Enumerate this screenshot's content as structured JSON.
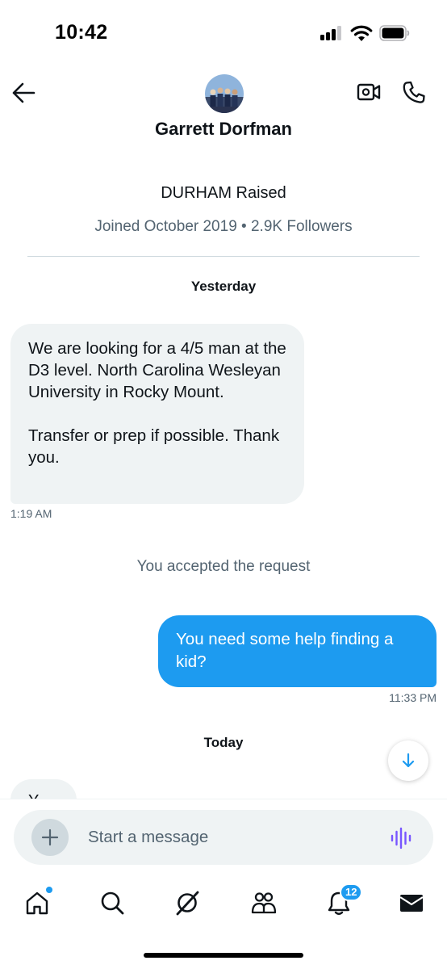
{
  "status_bar": {
    "time": "10:42",
    "signal_bars_active": 3,
    "signal_bars_total": 4
  },
  "header": {
    "back_icon": "arrow-left-icon",
    "name": "Garrett Dorfman",
    "video_icon": "video-camera-icon",
    "phone_icon": "phone-icon"
  },
  "profile": {
    "bio": "DURHAM Raised",
    "meta": "Joined October 2019 • 2.9K Followers"
  },
  "conversation": {
    "day_1": "Yesterday",
    "incoming_message": {
      "paragraph_1": "We are looking for a 4/5 man at the D3 level. North Carolina Wesleyan University in Rocky Mount.",
      "paragraph_2": "Transfer or prep if possible. Thank you.",
      "time": "1:19 AM"
    },
    "system_note": "You accepted the request",
    "outgoing_message": {
      "text": "You need some help finding a kid?",
      "time": "11:33 PM"
    },
    "day_2": "Today",
    "partial_message_start": "Y..."
  },
  "composer": {
    "placeholder": "Start a message",
    "add_icon": "plus-icon",
    "voice_icon": "voice-waveform-icon"
  },
  "bottom_nav": {
    "items": [
      "home-icon",
      "search-icon",
      "grok-icon",
      "communities-icon",
      "notifications-icon",
      "messages-icon"
    ],
    "notifications_badge": "12"
  },
  "colors": {
    "accent": "#1d9bf0",
    "text_primary": "#0f1419",
    "text_secondary": "#536471",
    "bubble_incoming": "#eff3f4",
    "voice_icon": "#7856ff"
  }
}
